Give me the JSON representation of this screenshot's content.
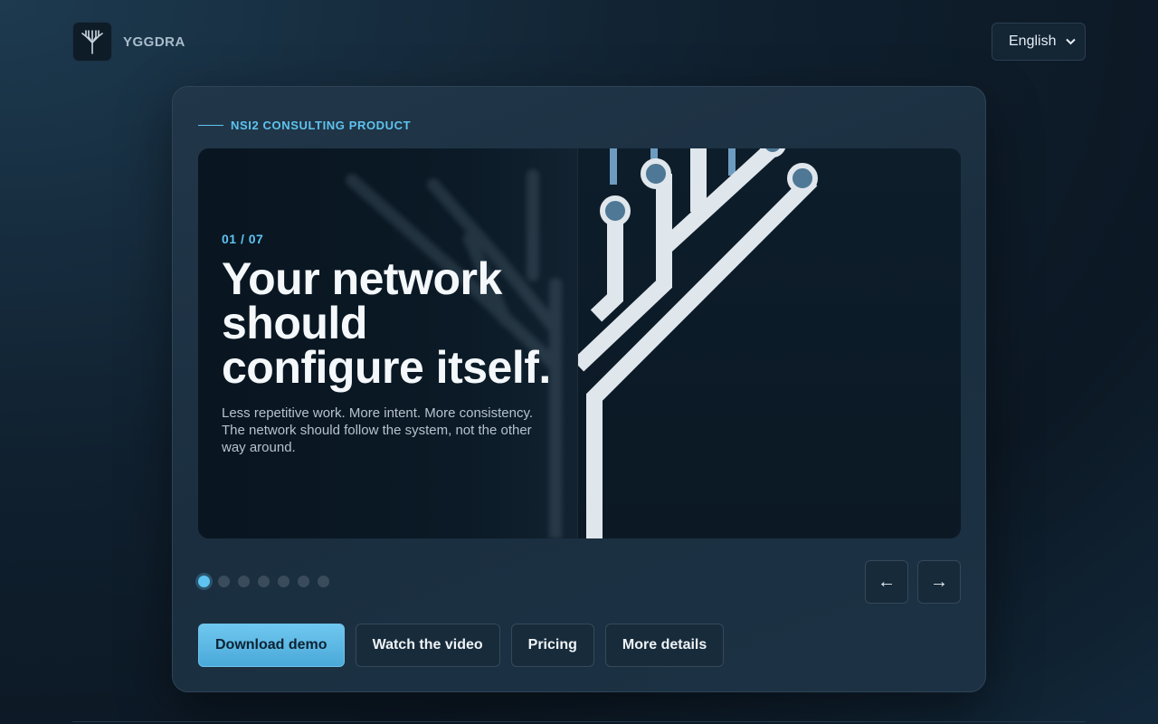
{
  "header": {
    "brand_name": "YGGDRA",
    "logo_icon": "tree-icon",
    "language": {
      "selected": "English",
      "options": [
        "English"
      ]
    }
  },
  "card": {
    "eyebrow": "NSI2 CONSULTING PRODUCT",
    "slide": {
      "counter": "01 / 07",
      "title": "Your network should configure itself.",
      "description": "Less repetitive work. More intent. More consistency. The network should follow the system, not the other way around.",
      "illustration_icon": "circuit-tree-icon"
    },
    "pagination": {
      "total": 7,
      "active_index": 0
    },
    "nav": {
      "prev_label": "←",
      "next_label": "→"
    },
    "actions": {
      "download_label": "Download demo",
      "video_label": "Watch the video",
      "pricing_label": "Pricing",
      "details_label": "More details"
    }
  },
  "colors": {
    "accent": "#5ec3f0",
    "primary_button": "#5cb8e6",
    "background": "#10202f"
  }
}
